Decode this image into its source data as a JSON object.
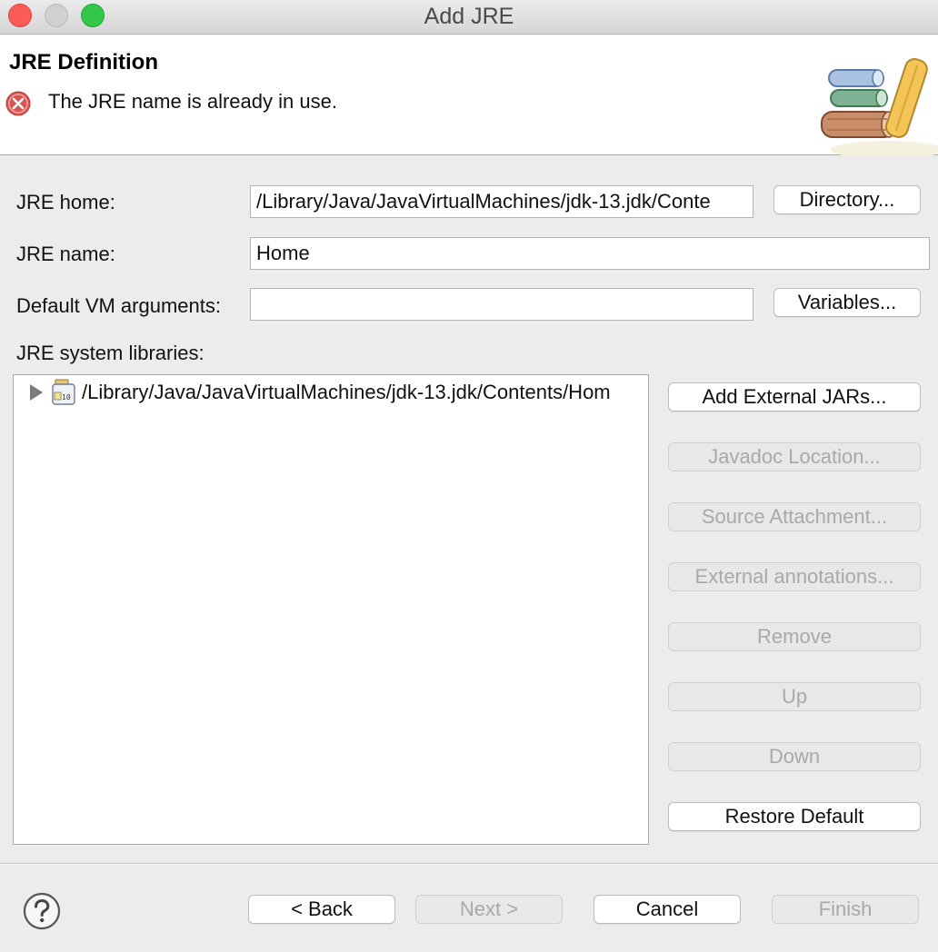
{
  "window": {
    "title": "Add JRE"
  },
  "banner": {
    "title": "JRE Definition",
    "error_message": "The JRE name is already in use."
  },
  "form": {
    "jre_home_label": "JRE home:",
    "jre_home_value": "/Library/Java/JavaVirtualMachines/jdk-13.jdk/Conte",
    "directory_button": "Directory...",
    "jre_name_label": "JRE name:",
    "jre_name_value": "Home",
    "vm_args_label": "Default VM arguments:",
    "vm_args_value": "",
    "variables_button": "Variables...",
    "system_libraries_label": "JRE system libraries:"
  },
  "libraries": {
    "items": [
      {
        "label": "/Library/Java/JavaVirtualMachines/jdk-13.jdk/Contents/Hom",
        "icon": "jar-icon",
        "expanded": false
      }
    ],
    "buttons": {
      "add_external_jars": "Add External JARs...",
      "javadoc_location": "Javadoc Location...",
      "source_attachment": "Source Attachment...",
      "external_annotations": "External annotations...",
      "remove": "Remove",
      "up": "Up",
      "down": "Down",
      "restore_default": "Restore Default"
    }
  },
  "footer": {
    "back": "< Back",
    "next": "Next >",
    "cancel": "Cancel",
    "finish": "Finish"
  },
  "colors": {
    "error": "#d9534f",
    "close": "#fc5b57",
    "maximize": "#34c84a",
    "disabled_text": "#a9a9a9"
  }
}
